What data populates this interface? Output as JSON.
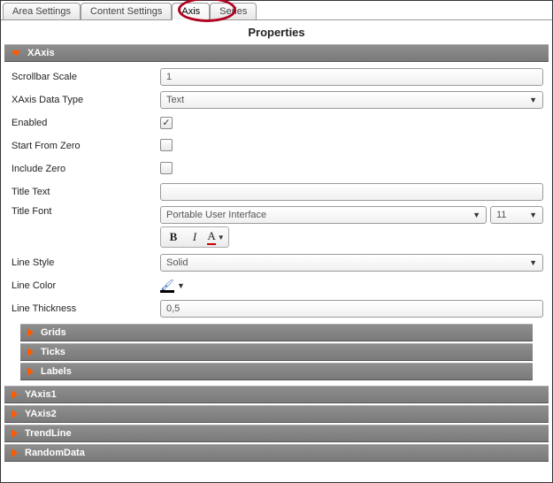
{
  "tabs": {
    "area": "Area Settings",
    "content": "Content Settings",
    "axis": "Axis",
    "series": "Series"
  },
  "title": "Properties",
  "sections": {
    "xaxis": "XAxis",
    "grids": "Grids",
    "ticks": "Ticks",
    "labels": "Labels",
    "yaxis1": "YAxis1",
    "yaxis2": "YAxis2",
    "trendline": "TrendLine",
    "randomdata": "RandomData"
  },
  "xaxis": {
    "scrollbarScale": {
      "label": "Scrollbar Scale",
      "value": "1"
    },
    "dataType": {
      "label": "XAxis Data Type",
      "value": "Text"
    },
    "enabled": {
      "label": "Enabled",
      "checked": true
    },
    "startFromZero": {
      "label": "Start From Zero",
      "checked": false
    },
    "includeZero": {
      "label": "Include Zero",
      "checked": false
    },
    "titleText": {
      "label": "Title Text",
      "value": ""
    },
    "titleFont": {
      "label": "Title Font",
      "font": "Portable User Interface",
      "size": "11"
    },
    "lineStyle": {
      "label": "Line Style",
      "value": "Solid"
    },
    "lineColor": {
      "label": "Line Color"
    },
    "lineThickness": {
      "label": "Line Thickness",
      "value": "0,5"
    }
  },
  "fmt": {
    "bold": "B",
    "italic": "I",
    "underline": "A"
  }
}
